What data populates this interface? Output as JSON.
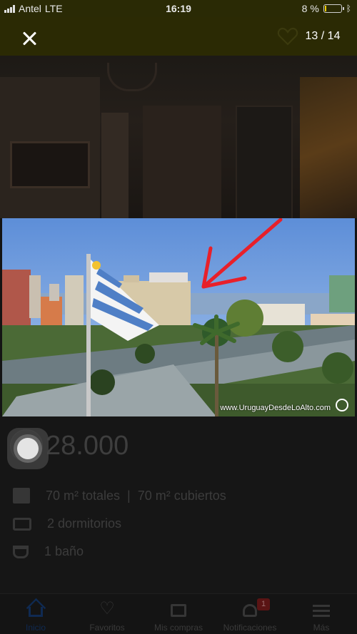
{
  "status_bar": {
    "carrier": "Antel",
    "network": "LTE",
    "time": "16:19",
    "battery": "8 %"
  },
  "viewer": {
    "counter": "13 / 14",
    "watermark": "www.UruguayDesdeLoAlto.com"
  },
  "listing": {
    "price_amount": "28.000",
    "area": "70 m² totales  |  70 m² cubiertos",
    "bedrooms": "2 dormitorios",
    "bathrooms": "1 baño"
  },
  "tabbar": {
    "items": [
      {
        "label": "Inicio"
      },
      {
        "label": "Favoritos"
      },
      {
        "label": "Mis compras"
      },
      {
        "label": "Notificaciones"
      },
      {
        "label": "Más"
      }
    ],
    "notification_count": "1"
  },
  "colors": {
    "toolbar": "#2b2a04",
    "active_tab": "#0f2a52",
    "annotation_arrow": "#e8202a"
  }
}
